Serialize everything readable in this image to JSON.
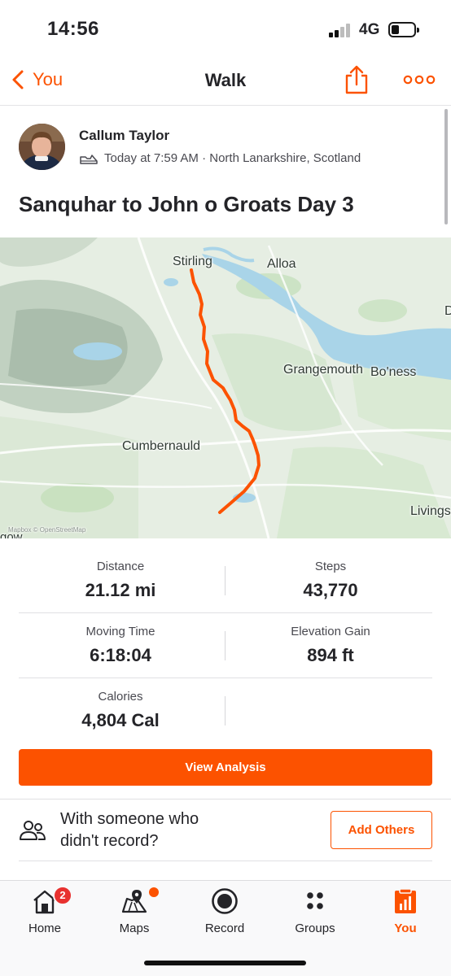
{
  "status_bar": {
    "time": "14:56",
    "network": "4G"
  },
  "nav": {
    "back_label": "You",
    "title": "Walk"
  },
  "activity": {
    "athlete_name": "Callum Taylor",
    "meta": "Today at 7:59 AM · North Lanarkshire, Scotland",
    "title": "Sanquhar to John o Groats Day 3"
  },
  "map": {
    "labels": {
      "stirling": "Stirling",
      "alloa": "Alloa",
      "grangemouth": "Grangemouth",
      "boness": "Bo'ness",
      "cumbernauld": "Cumbernauld",
      "livingston": "Livings",
      "edge_d": "D",
      "edge_gow": "gow",
      "attribution": "Mapbox © OpenStreetMap"
    },
    "route_color": "#fc5200"
  },
  "stats": {
    "distance": {
      "label": "Distance",
      "value": "21.12 mi"
    },
    "steps": {
      "label": "Steps",
      "value": "43,770"
    },
    "moving_time": {
      "label": "Moving Time",
      "value": "6:18:04"
    },
    "elevation_gain": {
      "label": "Elevation Gain",
      "value": "894 ft"
    },
    "calories": {
      "label": "Calories",
      "value": "4,804 Cal"
    }
  },
  "actions": {
    "view_analysis": "View Analysis",
    "with_someone": "With someone who didn't record?",
    "add_others": "Add Others"
  },
  "tab_bar": {
    "tabs": [
      {
        "label": "Home",
        "icon": "home-icon",
        "badge": "2"
      },
      {
        "label": "Maps",
        "icon": "maps-icon"
      },
      {
        "label": "Record",
        "icon": "record-icon"
      },
      {
        "label": "Groups",
        "icon": "groups-icon"
      },
      {
        "label": "You",
        "icon": "you-icon",
        "active": true
      }
    ]
  },
  "colors": {
    "accent": "#fc5200",
    "badge": "#e8312f",
    "text": "#242428"
  }
}
